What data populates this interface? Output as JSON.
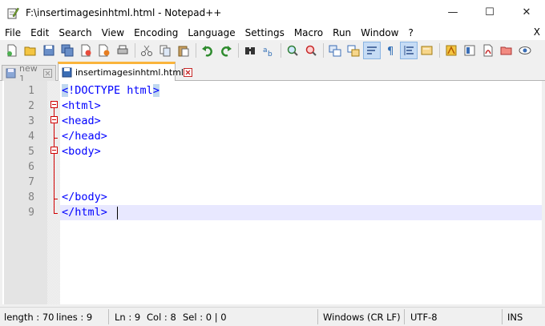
{
  "window": {
    "title": "F:\\insertimagesinhtml.html - Notepad++",
    "minimize_glyph": "—",
    "maximize_glyph": "☐",
    "close_glyph": "✕"
  },
  "menu": {
    "items": [
      "File",
      "Edit",
      "Search",
      "View",
      "Encoding",
      "Language",
      "Settings",
      "Macro",
      "Run",
      "Window",
      "?"
    ],
    "close_label": "X"
  },
  "toolbar": {
    "icons": [
      "new-file-icon",
      "open-file-icon",
      "save-icon",
      "save-all-icon",
      "close-icon",
      "close-all-icon",
      "print-icon",
      "cut-icon",
      "copy-icon",
      "paste-icon",
      "undo-icon",
      "redo-icon",
      "find-icon",
      "replace-icon",
      "zoom-in-icon",
      "zoom-out-icon",
      "sync-vertical-icon",
      "sync-horizontal-icon",
      "word-wrap-icon",
      "show-all-chars-icon",
      "indent-guide-icon",
      "function-list-icon",
      "folder-as-workspace-icon",
      "document-map-icon",
      "pdf-icon",
      "folder-icon",
      "monitoring-icon"
    ]
  },
  "tabs": [
    {
      "label": "new 1",
      "active": false
    },
    {
      "label": "insertimagesinhtml.html",
      "active": true
    }
  ],
  "editor": {
    "lines": [
      {
        "number": "1",
        "text": "<!DOCTYPE html>"
      },
      {
        "number": "2",
        "text": "<html>"
      },
      {
        "number": "3",
        "text": "<head>"
      },
      {
        "number": "4",
        "text": "</head>"
      },
      {
        "number": "5",
        "text": "<body>"
      },
      {
        "number": "6",
        "text": ""
      },
      {
        "number": "7",
        "text": ""
      },
      {
        "number": "8",
        "text": "</body>"
      },
      {
        "number": "9",
        "text": "</html>"
      }
    ],
    "current_line": 9
  },
  "status": {
    "length": "length : 70",
    "lines": "lines : 9",
    "ln": "Ln : 9",
    "col": "Col : 8",
    "sel": "Sel : 0 | 0",
    "eol": "Windows (CR LF)",
    "encoding": "UTF-8",
    "mode": "INS"
  },
  "colors": {
    "tag": "#0000ff",
    "fold": "#d00000",
    "current_line": "#e8e8ff",
    "active_tab_accent": "#fab43c",
    "brace_highlight": "#c0d8f0"
  }
}
